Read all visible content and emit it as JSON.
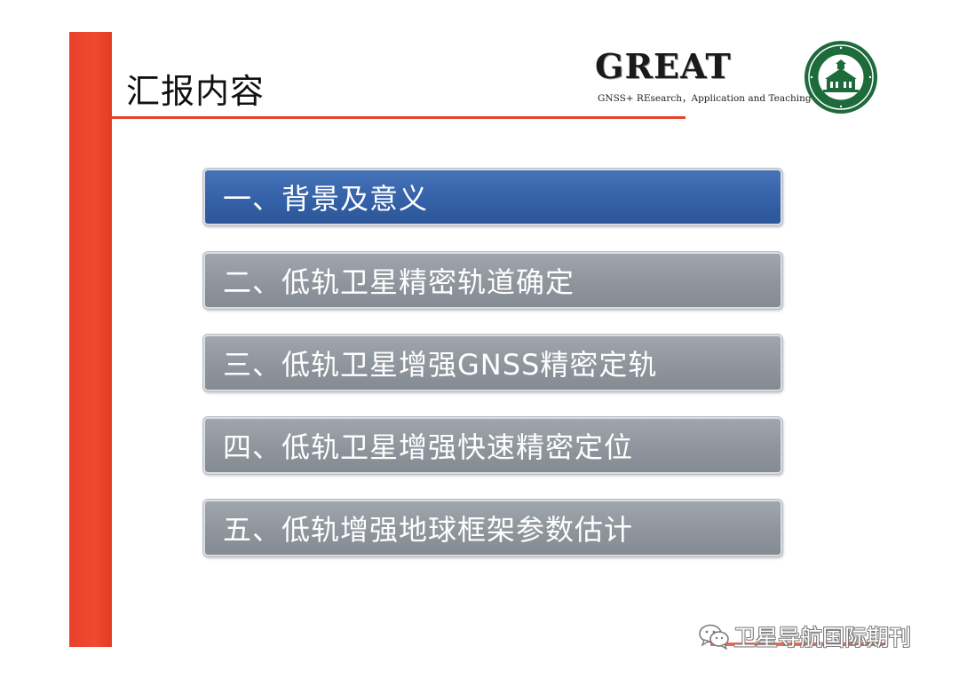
{
  "slide": {
    "title": "汇报内容",
    "logo": {
      "wordmark": "GREAT",
      "tagline": "GNSS+ REsearch，Application and Teaching"
    },
    "menu": [
      {
        "label": "一、背景及意义",
        "state": "active"
      },
      {
        "label": "二、低轨卫星精密轨道确定",
        "state": "inactive"
      },
      {
        "label": "三、低轨卫星增强GNSS精密定轨",
        "state": "inactive"
      },
      {
        "label": "四、低轨卫星增强快速精密定位",
        "state": "inactive"
      },
      {
        "label": "五、低轨增强地球框架参数估计",
        "state": "inactive"
      }
    ],
    "watermark": "卫星导航国际期刊"
  },
  "colors": {
    "accent_red": "#e8412a",
    "active_blue": "#3461a8",
    "inactive_gray": "#8f959d",
    "seal_green": "#1d6b3a"
  },
  "icons": {
    "seal": "university-seal-icon",
    "watermark": "wechat-icon"
  }
}
